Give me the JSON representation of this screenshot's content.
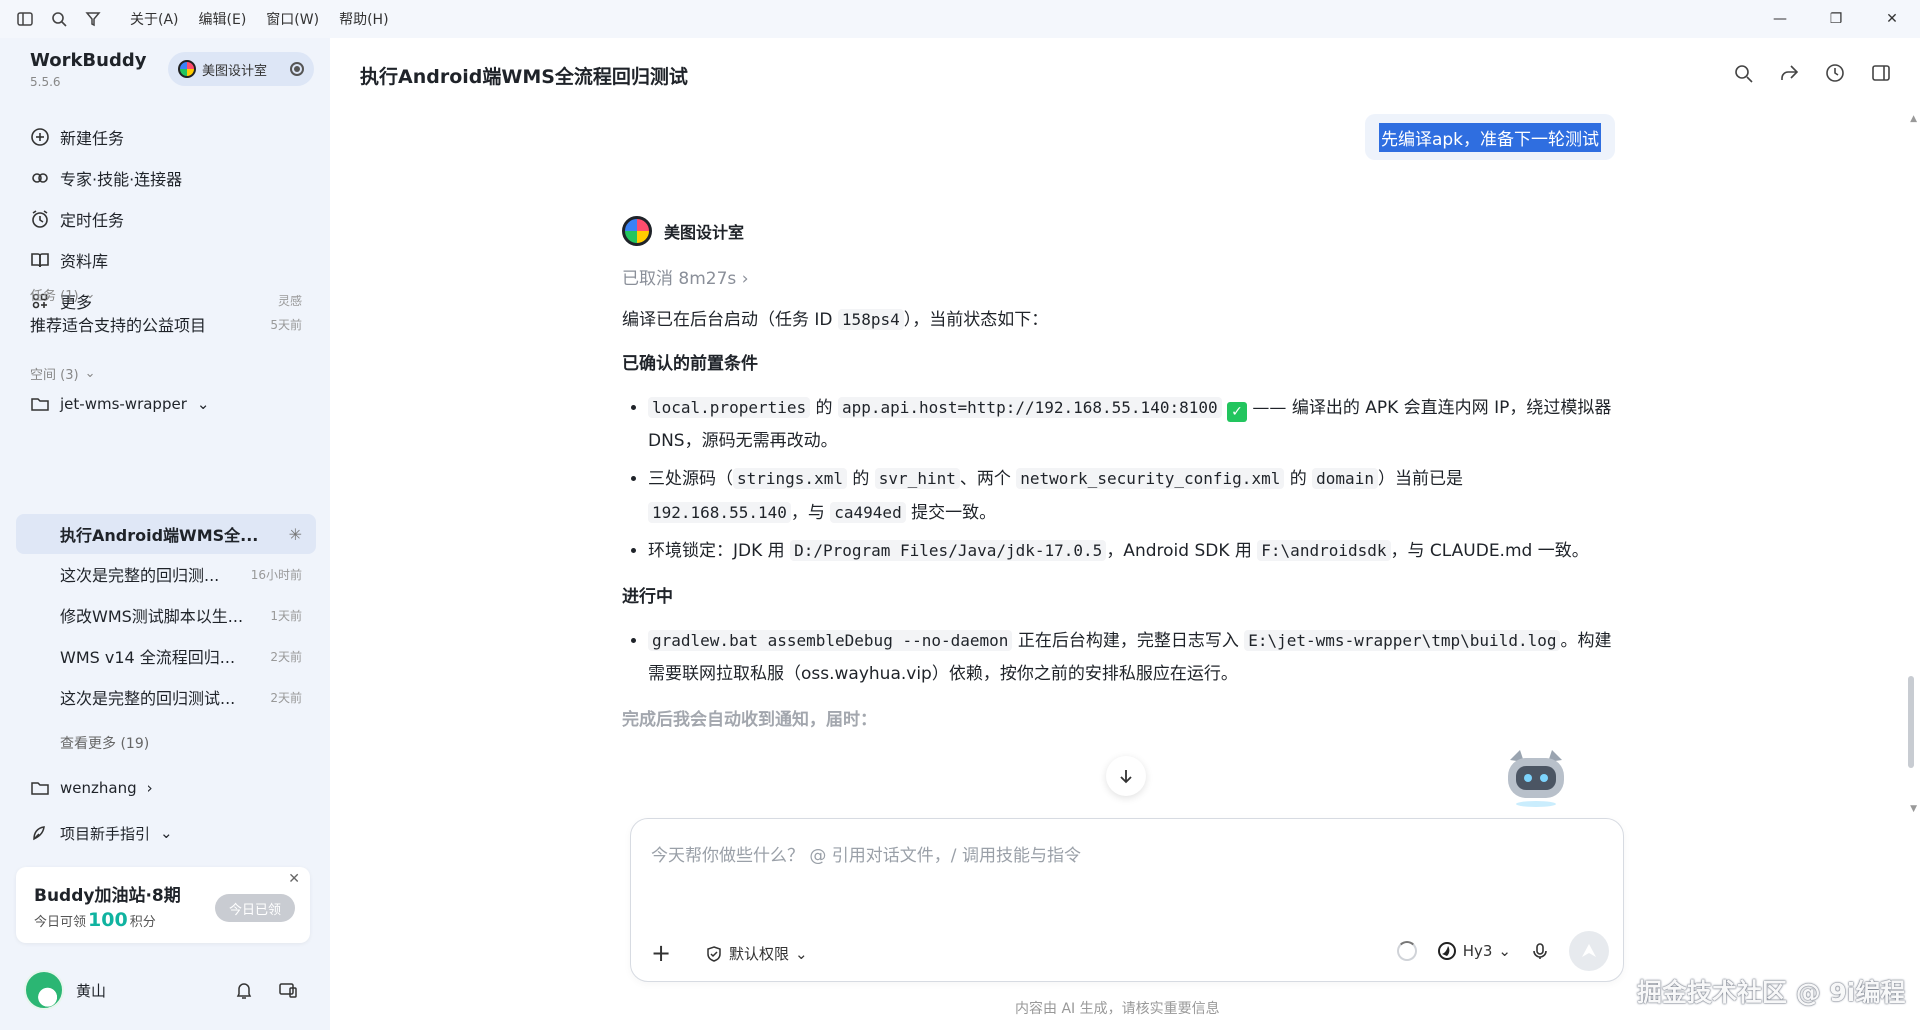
{
  "titlebar": {
    "menus": [
      "关于(A)",
      "编辑(E)",
      "窗口(W)",
      "帮助(H)"
    ],
    "minimize": "—",
    "maximize": "❐",
    "close": "✕"
  },
  "sidebar": {
    "brand": "WorkBuddy",
    "version": "5.5.6",
    "studio": "美图设计室",
    "nav": [
      {
        "label": "新建任务",
        "icon": "plus-circle-icon"
      },
      {
        "label": "专家·技能·连接器",
        "icon": "expert-icon"
      },
      {
        "label": "定时任务",
        "icon": "alarm-clock-icon"
      },
      {
        "label": "资料库",
        "icon": "book-icon"
      },
      {
        "label": "更多",
        "icon": "grid-icon",
        "aux": "灵感"
      }
    ],
    "tasks_header": "任务 (1)",
    "tasks": [
      {
        "label": "推荐适合支持的公益项目",
        "time": "5天前"
      }
    ],
    "spaces_header": "空间 (3)",
    "space1": "jet-wms-wrapper",
    "space1_items": [
      {
        "label": "执行Android端WMS全...",
        "time": ""
      },
      {
        "label": "这次是完整的回归测...",
        "time": "16小时前"
      },
      {
        "label": "修改WMS测试脚本以生...",
        "time": "1天前"
      },
      {
        "label": "WMS v14 全流程回归...",
        "time": "2天前"
      },
      {
        "label": "这次是完整的回归测试...",
        "time": "2天前"
      }
    ],
    "see_more": "查看更多 (19)",
    "space2": "wenzhang",
    "space3": "项目新手指引",
    "promo": {
      "title": "Buddy加油站·8期",
      "sub_prefix": "今日可领",
      "points": "100",
      "sub_suffix": "积分",
      "button": "今日已领"
    },
    "user": "黄山"
  },
  "main": {
    "title": "执行Android端WMS全流程回归测试",
    "user_message": "先编译apk，准备下一轮测试",
    "assistant_name": "美图设计室",
    "cancelled": "已取消 8m27s",
    "intro_a": "编译已在后台启动（任务 ID ",
    "intro_code": "158ps4",
    "intro_b": "），当前状态如下：",
    "h_prereq": "已确认的前置条件",
    "b1": {
      "c1": "local.properties",
      "t1": " 的 ",
      "c2": "app.api.host=http://192.168.55.140:8100",
      "t2": " —— 编译出的 APK 会直连内网 IP，绕过模拟器 DNS，源码无需再改动。"
    },
    "b2": {
      "t0": "三处源码（",
      "c1": "strings.xml",
      "t1": " 的 ",
      "c2": "svr_hint",
      "t2": "、两个 ",
      "c3": "network_security_config.xml",
      "t3": " 的 ",
      "c4": "domain",
      "t4": "）当前已是 ",
      "c5": "192.168.55.140",
      "t5": "，与 ",
      "c6": "ca494ed",
      "t6": " 提交一致。"
    },
    "b3": {
      "t0": "环境锁定：JDK 用 ",
      "c1": "D:/Program Files/Java/jdk-17.0.5",
      "t1": "，Android SDK 用 ",
      "c2": "F:\\androidsdk",
      "t2": "，与 CLAUDE.md 一致。"
    },
    "h_progress": "进行中",
    "b4": {
      "c1": "gradlew.bat assembleDebug --no-daemon",
      "t1": " 正在后台构建，完整日志写入 ",
      "c2": "E:\\jet-wms-wrapper\\tmp\\build.log",
      "t2": "。构建需要联网拉取私服（oss.wayhua.vip）依赖，按你之前的安排私服应在运行。"
    },
    "faded": "完成后我会自动收到通知，届时：",
    "composer": {
      "placeholder": "今天帮你做些什么？ @ 引用对话文件，/ 调用技能与指令",
      "permission": "默认权限",
      "model": "Hy3"
    },
    "footnote": "内容由 AI 生成，请核实重要信息",
    "watermark": "掘金技术社区 @ 9i编程"
  }
}
